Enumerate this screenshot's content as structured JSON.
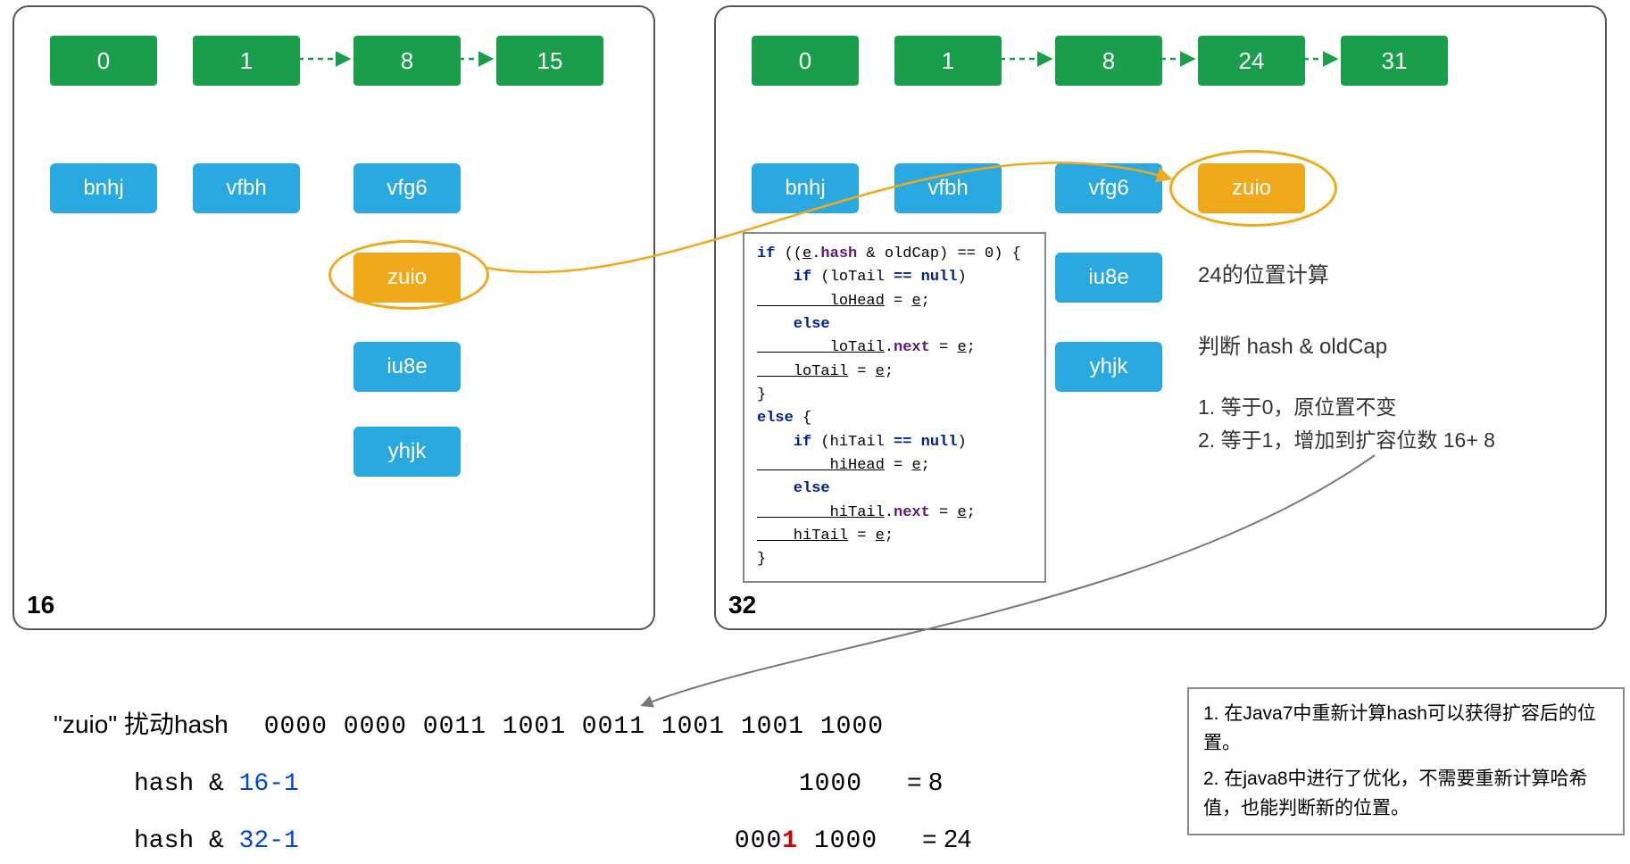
{
  "left": {
    "label": "16",
    "buckets": [
      "0",
      "1",
      "8",
      "15"
    ],
    "col0": [
      "bnhj"
    ],
    "col1": [
      "vfbh"
    ],
    "col2": [
      "vfg6",
      "zuio",
      "iu8e",
      "yhjk"
    ]
  },
  "right": {
    "label": "32",
    "buckets": [
      "0",
      "1",
      "8",
      "24",
      "31"
    ],
    "col0": [
      "bnhj"
    ],
    "col1": [
      "vfbh"
    ],
    "col2": [
      "vfg6",
      "iu8e",
      "yhjk"
    ],
    "col3": [
      "zuio"
    ]
  },
  "code": {
    "l1a": "if",
    "l1b": " ((",
    "l1c": "e",
    "l1d": ".",
    "l1e": "hash",
    "l1f": " & oldCap) == 0) {",
    "l2a": "    if",
    "l2b": " (loTail ",
    "l2c": "==",
    "l2d": " ",
    "l2e": "null",
    "l2f": ")",
    "l3": "        loHead",
    "l3b": " = ",
    "l3c": "e",
    "l3d": ";",
    "l4": "    else",
    "l5": "        loTail",
    "l5b": ".",
    "l5c": "next",
    "l5d": " = ",
    "l5e": "e",
    "l5f": ";",
    "l6": "    loTail",
    "l6b": " = ",
    "l6c": "e",
    "l6d": ";",
    "l7": "}",
    "l8": "else",
    "l8b": " {",
    "l9a": "    if",
    "l9b": " (hiTail ",
    "l9c": "==",
    "l9d": " ",
    "l9e": "null",
    "l9f": ")",
    "l10": "        hiHead",
    "l10b": " = ",
    "l10c": "e",
    "l10d": ";",
    "l11": "    else",
    "l12": "        hiTail",
    "l12b": ".",
    "l12c": "next",
    "l12d": " = ",
    "l12e": "e",
    "l12f": ";",
    "l13": "    hiTail",
    "l13b": " = ",
    "l13c": "e",
    "l13d": ";",
    "l14": "}"
  },
  "info": {
    "title": "24的位置计算",
    "sub": "判断 hash & oldCap",
    "li1": "1.   等于0，原位置不变",
    "li2": "2.   等于1，增加到扩容位数 16+ 8"
  },
  "calc": {
    "label": "\"zuio\"   扰动hash",
    "binary": "0000 0000 0011 1001 0011 1001 1001 1000",
    "row2a": "hash & ",
    "row2b": "16-1",
    "row2v": "1000",
    "row2e": "= 8",
    "row3a": "hash & ",
    "row3b": "32-1",
    "row3v_pre": "000",
    "row3v_red": "1",
    "row3v_post": " 1000",
    "row3e": "= 24"
  },
  "note": {
    "n1": "1.   在Java7中重新计算hash可以获得扩容后的位置。",
    "n2": "2.   在java8中进行了优化，不需要重新计算哈希值，也能判断新的位置。"
  }
}
